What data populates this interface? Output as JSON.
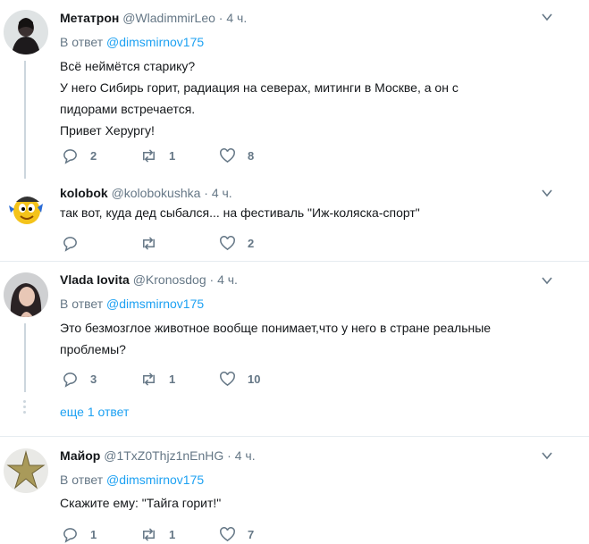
{
  "tweets": [
    {
      "name": "Метатрон",
      "handle": "@WladimmirLeo",
      "time": "· 4 ч.",
      "reply_prefix": "В ответ",
      "reply_mention": "@dimsmirnov175",
      "lines": [
        "Всё неймётся старику?",
        "У него Сибирь горит, радиация на северах, митинги в Москве, а он с",
        "пидорами встречается.",
        "Привет Херургу!"
      ],
      "replies": "2",
      "retweets": "1",
      "likes": "8"
    },
    {
      "name": "kolobok",
      "handle": "@kolobokushka",
      "time": "· 4 ч.",
      "lines": [
        "так вот, куда дед сыбался... на фестиваль \"Иж-коляска-спорт\""
      ],
      "replies": "",
      "retweets": "",
      "likes": "2"
    },
    {
      "name": "Vlada Iovita",
      "handle": "@Kronosdog",
      "time": "· 4 ч.",
      "reply_prefix": "В ответ",
      "reply_mention": "@dimsmirnov175",
      "lines": [
        "Это безмозглое животное вообще понимает,что у него в стране реальные",
        "проблемы?"
      ],
      "replies": "3",
      "retweets": "1",
      "likes": "10",
      "more_replies": "еще 1 ответ"
    },
    {
      "name": "Майор",
      "handle": "@1TxZ0Thjz1nEnHG",
      "time": "· 4 ч.",
      "reply_prefix": "В ответ",
      "reply_mention": "@dimsmirnov175",
      "lines": [
        "Скажите ему: \"Тайга горит!\""
      ],
      "replies": "1",
      "retweets": "1",
      "likes": "7"
    }
  ],
  "colors": {
    "accent": "#1da1f2",
    "secondary_text": "#657786",
    "divider": "#e6ecf0"
  },
  "icons": [
    "reply-icon",
    "retweet-icon",
    "like-icon",
    "caret-down-icon"
  ]
}
